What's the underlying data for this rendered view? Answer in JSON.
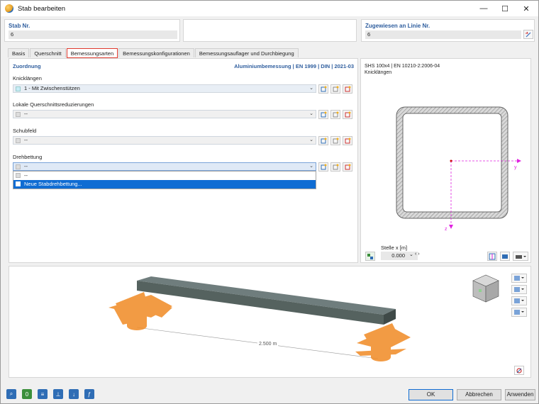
{
  "window": {
    "title": "Stab bearbeiten",
    "minimize_glyph": "—",
    "maximize_glyph": "☐",
    "close_glyph": "✕"
  },
  "stab": {
    "label": "Stab Nr.",
    "value": "6"
  },
  "zugewiesen": {
    "label": "Zugewiesen an Linie Nr.",
    "value": "6"
  },
  "tabs": [
    {
      "label": "Basis"
    },
    {
      "label": "Querschnitt"
    },
    {
      "label": "Bemessungsarten",
      "active": true
    },
    {
      "label": "Bemessungskonfigurationen"
    },
    {
      "label": "Bemessungsauflager und Durchbiegung"
    }
  ],
  "zuordnung": {
    "title": "Zuordnung",
    "norm": "Aluminiumbemessung | EN 1999 | DIN | 2021-03",
    "fields": [
      {
        "label": "Knicklängen",
        "value": "1 - Mit Zwischenstützen"
      },
      {
        "label": "Lokale Querschnittsreduzierungen",
        "value": "--"
      },
      {
        "label": "Schubfeld",
        "value": "--"
      },
      {
        "label": "Drehbettung",
        "value": "--"
      }
    ],
    "dropdown_options": [
      {
        "label": "--"
      },
      {
        "label": "Neue Stabdrehbettung...",
        "selected": true
      }
    ]
  },
  "cross_section": {
    "name": "SHS 100x4 | EN 10210-2:2006-04",
    "subtitle": "Knicklängen",
    "axis_y": "y",
    "axis_z": "z",
    "stelle_label": "Stelle x [m]",
    "stelle_value": "0.000"
  },
  "view3d": {
    "dimension_label": "2.500 m"
  },
  "buttons": {
    "ok": "OK",
    "cancel": "Abbrechen",
    "apply": "Anwenden"
  },
  "colors": {
    "accent": "#2f5e9e",
    "highlight": "#e03b2f",
    "selection": "#0f6cd3",
    "support": "#f08a24",
    "beam": "#5d6b6b",
    "axis": "#e020e0"
  }
}
